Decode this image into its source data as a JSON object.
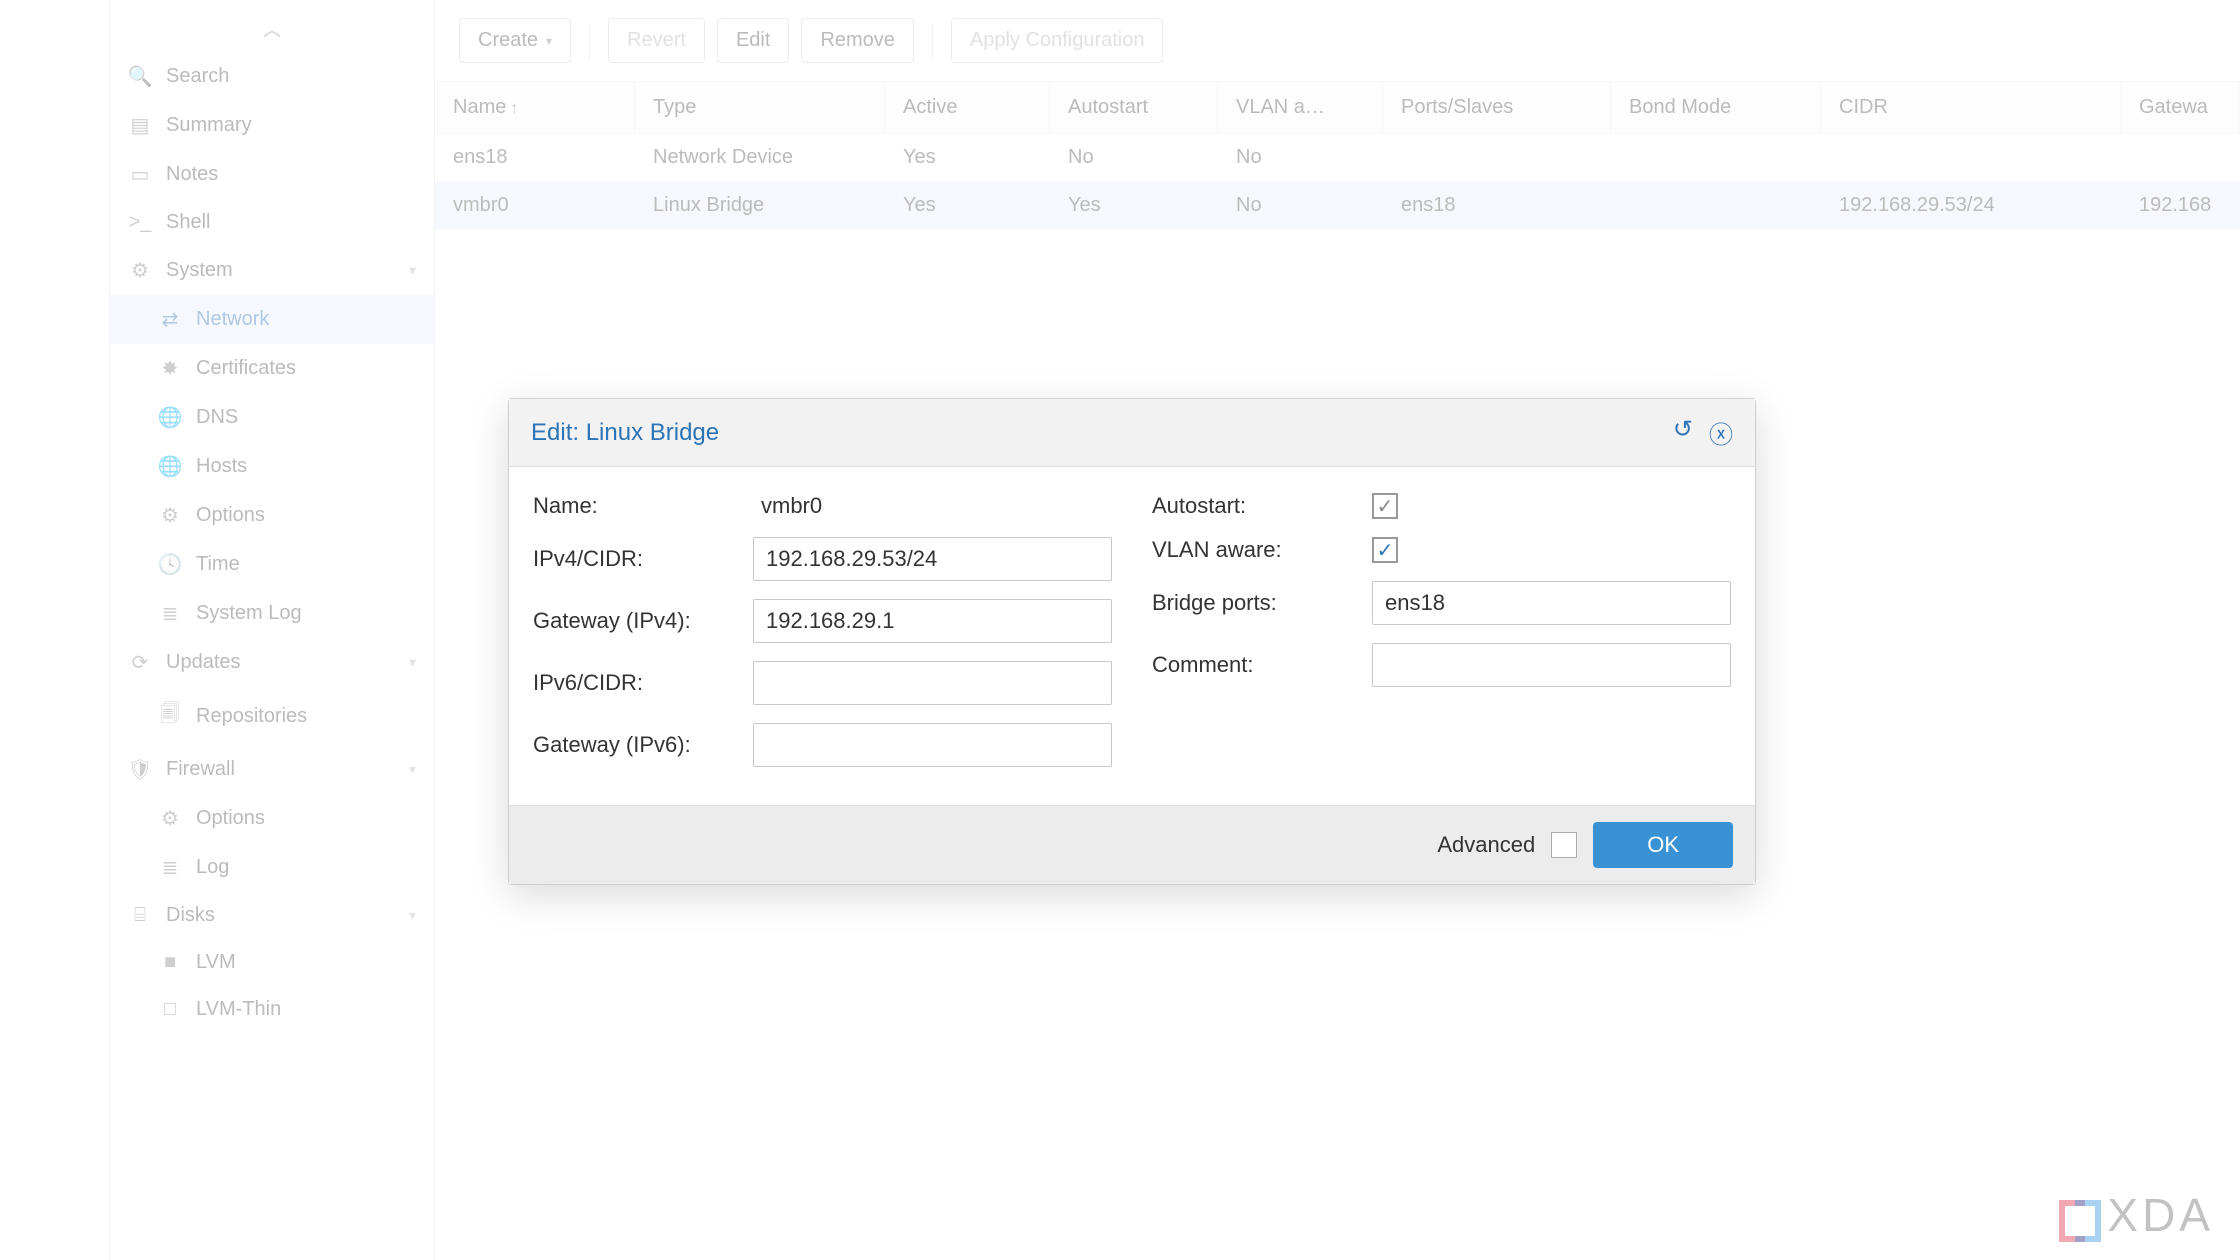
{
  "sidebar": {
    "items": [
      {
        "label": "Search",
        "icon": "search-icon"
      },
      {
        "label": "Summary",
        "icon": "book-icon"
      },
      {
        "label": "Notes",
        "icon": "note-icon"
      },
      {
        "label": "Shell",
        "icon": "terminal-icon"
      },
      {
        "label": "System",
        "icon": "gears-icon",
        "expandable": true
      },
      {
        "label": "Network",
        "icon": "network-icon",
        "level": 2,
        "active": true
      },
      {
        "label": "Certificates",
        "icon": "certificate-icon",
        "level": 2
      },
      {
        "label": "DNS",
        "icon": "globe-icon",
        "level": 2
      },
      {
        "label": "Hosts",
        "icon": "globe-icon",
        "level": 2
      },
      {
        "label": "Options",
        "icon": "gear-icon",
        "level": 2
      },
      {
        "label": "Time",
        "icon": "clock-icon",
        "level": 2
      },
      {
        "label": "System Log",
        "icon": "list-icon",
        "level": 2
      },
      {
        "label": "Updates",
        "icon": "refresh-icon",
        "expandable": true
      },
      {
        "label": "Repositories",
        "icon": "files-icon",
        "level": 2
      },
      {
        "label": "Firewall",
        "icon": "shield-icon",
        "expandable": true
      },
      {
        "label": "Options",
        "icon": "gear-icon",
        "level": 2
      },
      {
        "label": "Log",
        "icon": "list-icon",
        "level": 2
      },
      {
        "label": "Disks",
        "icon": "disk-icon",
        "expandable": true
      },
      {
        "label": "LVM",
        "icon": "square-icon",
        "level": 2
      },
      {
        "label": "LVM-Thin",
        "icon": "square-outline-icon",
        "level": 2
      }
    ]
  },
  "toolbar": {
    "create": "Create",
    "revert": "Revert",
    "edit": "Edit",
    "remove": "Remove",
    "apply": "Apply Configuration"
  },
  "grid": {
    "columns": {
      "name": "Name",
      "type": "Type",
      "active": "Active",
      "autostart": "Autostart",
      "vlan": "VLAN a…",
      "ports": "Ports/Slaves",
      "bond": "Bond Mode",
      "cidr": "CIDR",
      "gateway": "Gatewa"
    },
    "rows": [
      {
        "name": "ens18",
        "type": "Network Device",
        "active": "Yes",
        "autostart": "No",
        "vlan": "No",
        "ports": "",
        "bond": "",
        "cidr": "",
        "gateway": ""
      },
      {
        "name": "vmbr0",
        "type": "Linux Bridge",
        "active": "Yes",
        "autostart": "Yes",
        "vlan": "No",
        "ports": "ens18",
        "bond": "",
        "cidr": "192.168.29.53/24",
        "gateway": "192.168",
        "selected": true
      }
    ]
  },
  "dialog": {
    "title": "Edit: Linux Bridge",
    "fields": {
      "name_label": "Name:",
      "name_value": "vmbr0",
      "ipv4_label": "IPv4/CIDR:",
      "ipv4_value": "192.168.29.53/24",
      "gw4_label": "Gateway (IPv4):",
      "gw4_value": "192.168.29.1",
      "ipv6_label": "IPv6/CIDR:",
      "ipv6_value": "",
      "gw6_label": "Gateway (IPv6):",
      "gw6_value": "",
      "autostart_label": "Autostart:",
      "autostart_checked": true,
      "vlan_label": "VLAN aware:",
      "vlan_checked": true,
      "bridge_label": "Bridge ports:",
      "bridge_value": "ens18",
      "comment_label": "Comment:",
      "comment_value": ""
    },
    "footer": {
      "advanced": "Advanced",
      "ok": "OK"
    }
  },
  "watermark": "XDA",
  "icon_glyphs": {
    "search-icon": "🔍",
    "book-icon": "▤",
    "note-icon": "▭",
    "terminal-icon": ">_",
    "gears-icon": "⚙",
    "network-icon": "⇄",
    "certificate-icon": "✸",
    "globe-icon": "🌐",
    "gear-icon": "⚙",
    "clock-icon": "🕓",
    "list-icon": "≣",
    "refresh-icon": "⟳",
    "files-icon": "🗐",
    "shield-icon": "🛡",
    "disk-icon": "⌸",
    "square-icon": "■",
    "square-outline-icon": "□"
  }
}
